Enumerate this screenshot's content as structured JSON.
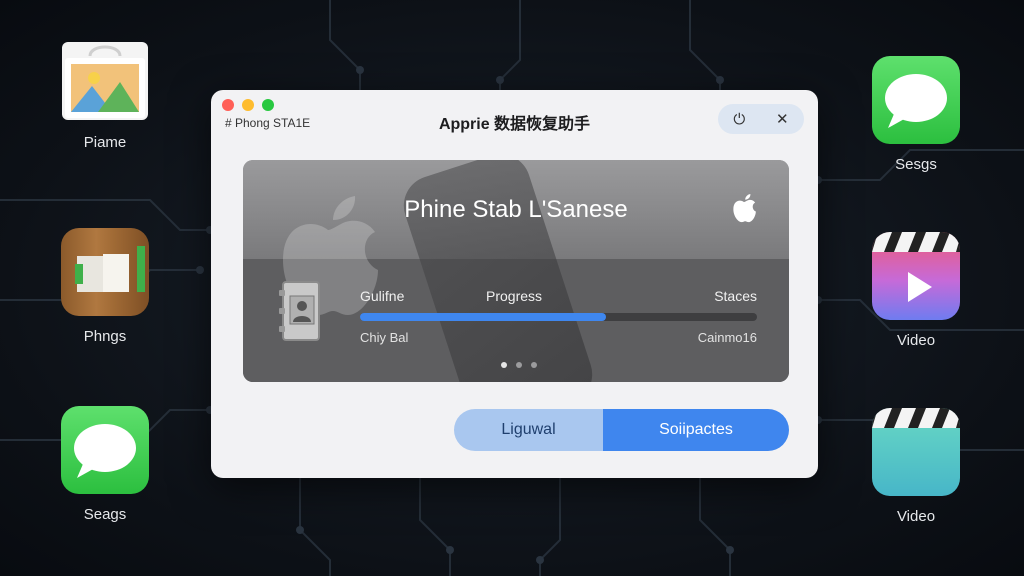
{
  "desktop": {
    "left_icons": [
      {
        "label": "Piame",
        "icon": "photos-bag-icon"
      },
      {
        "label": "Phngs",
        "icon": "books-icon"
      },
      {
        "label": "Seags",
        "icon": "messages-icon"
      }
    ],
    "right_icons": [
      {
        "label": "Sesgs",
        "icon": "messages-icon"
      },
      {
        "label": "Video",
        "icon": "video-clapper-icon"
      },
      {
        "label": "Video",
        "icon": "video-clapper-icon"
      }
    ]
  },
  "window": {
    "tag": "# Phong STA1E",
    "title": "Apprie 数据恢复助手",
    "controls": {
      "power_icon": "⏻",
      "close_icon": "✕"
    },
    "panel": {
      "title": "Phine Stab  L'Sanese",
      "col_left": "Gulifne",
      "col_mid": "Progress",
      "col_right": "Staces",
      "sub_left": "Chiy Bal",
      "sub_right": "Cainmo16",
      "progress_percent": 62,
      "page_count": 3,
      "active_page": 1
    },
    "buttons": {
      "left_label": "Liguwal",
      "right_label": "Soiipactes"
    }
  },
  "colors": {
    "accent": "#3f86ee",
    "accent_light": "#a9c7ef",
    "close_dot": "#ff5f57",
    "minimize_dot": "#febc2e",
    "zoom_dot": "#28c840"
  }
}
